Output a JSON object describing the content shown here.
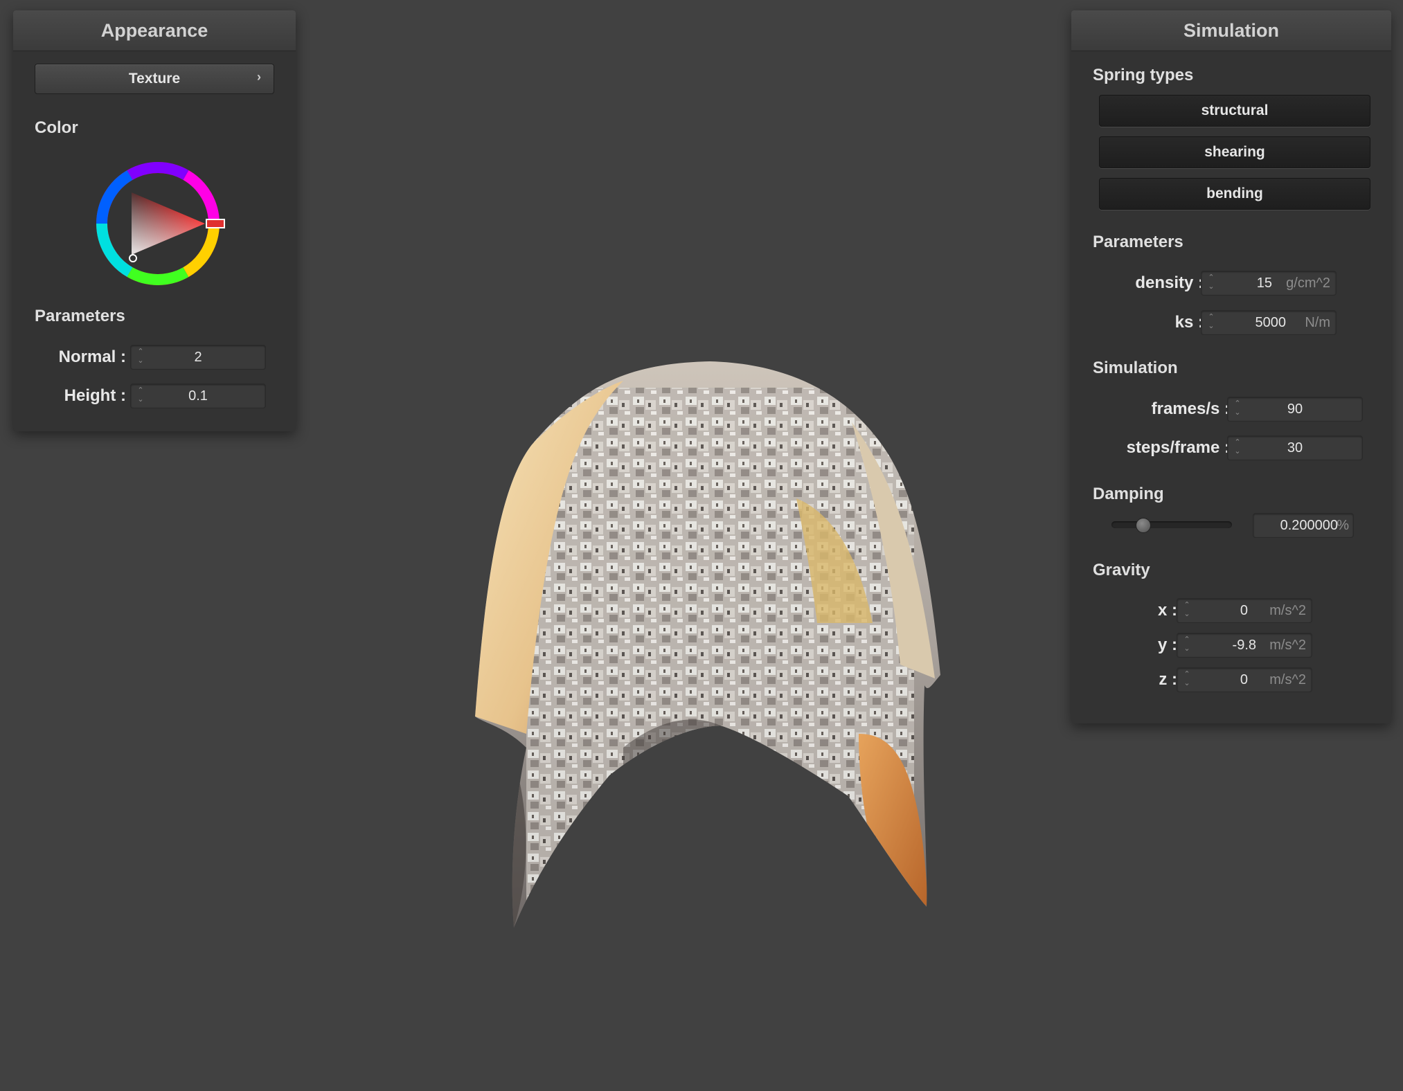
{
  "appearance": {
    "title": "Appearance",
    "texture_button": "Texture",
    "color_label": "Color",
    "color_wheel": {
      "selected_hue": "#ff0000"
    },
    "parameters_label": "Parameters",
    "normal_label": "Normal :",
    "normal_value": "2",
    "height_label": "Height :",
    "height_value": "0.1"
  },
  "simulation": {
    "title": "Simulation",
    "spring_types_label": "Spring types",
    "spring_buttons": [
      "structural",
      "shearing",
      "bending"
    ],
    "parameters_label": "Parameters",
    "density_label": "density :",
    "density_value": "15",
    "density_unit": "g/cm^2",
    "ks_label": "ks :",
    "ks_value": "5000",
    "ks_unit": "N/m",
    "simulation_label": "Simulation",
    "fps_label": "frames/s :",
    "fps_value": "90",
    "steps_label": "steps/frame :",
    "steps_value": "30",
    "damping_label": "Damping",
    "damping_level": 0.2,
    "damping_value": "0.200000",
    "damping_unit": "%",
    "gravity_label": "Gravity",
    "gx_label": "x :",
    "gx_value": "0",
    "gy_label": "y :",
    "gy_value": "-9.8",
    "gz_label": "z :",
    "gz_value": "0",
    "gravity_unit": "m/s^2"
  },
  "colors": {
    "background": "#414141",
    "panel": "#333333"
  }
}
